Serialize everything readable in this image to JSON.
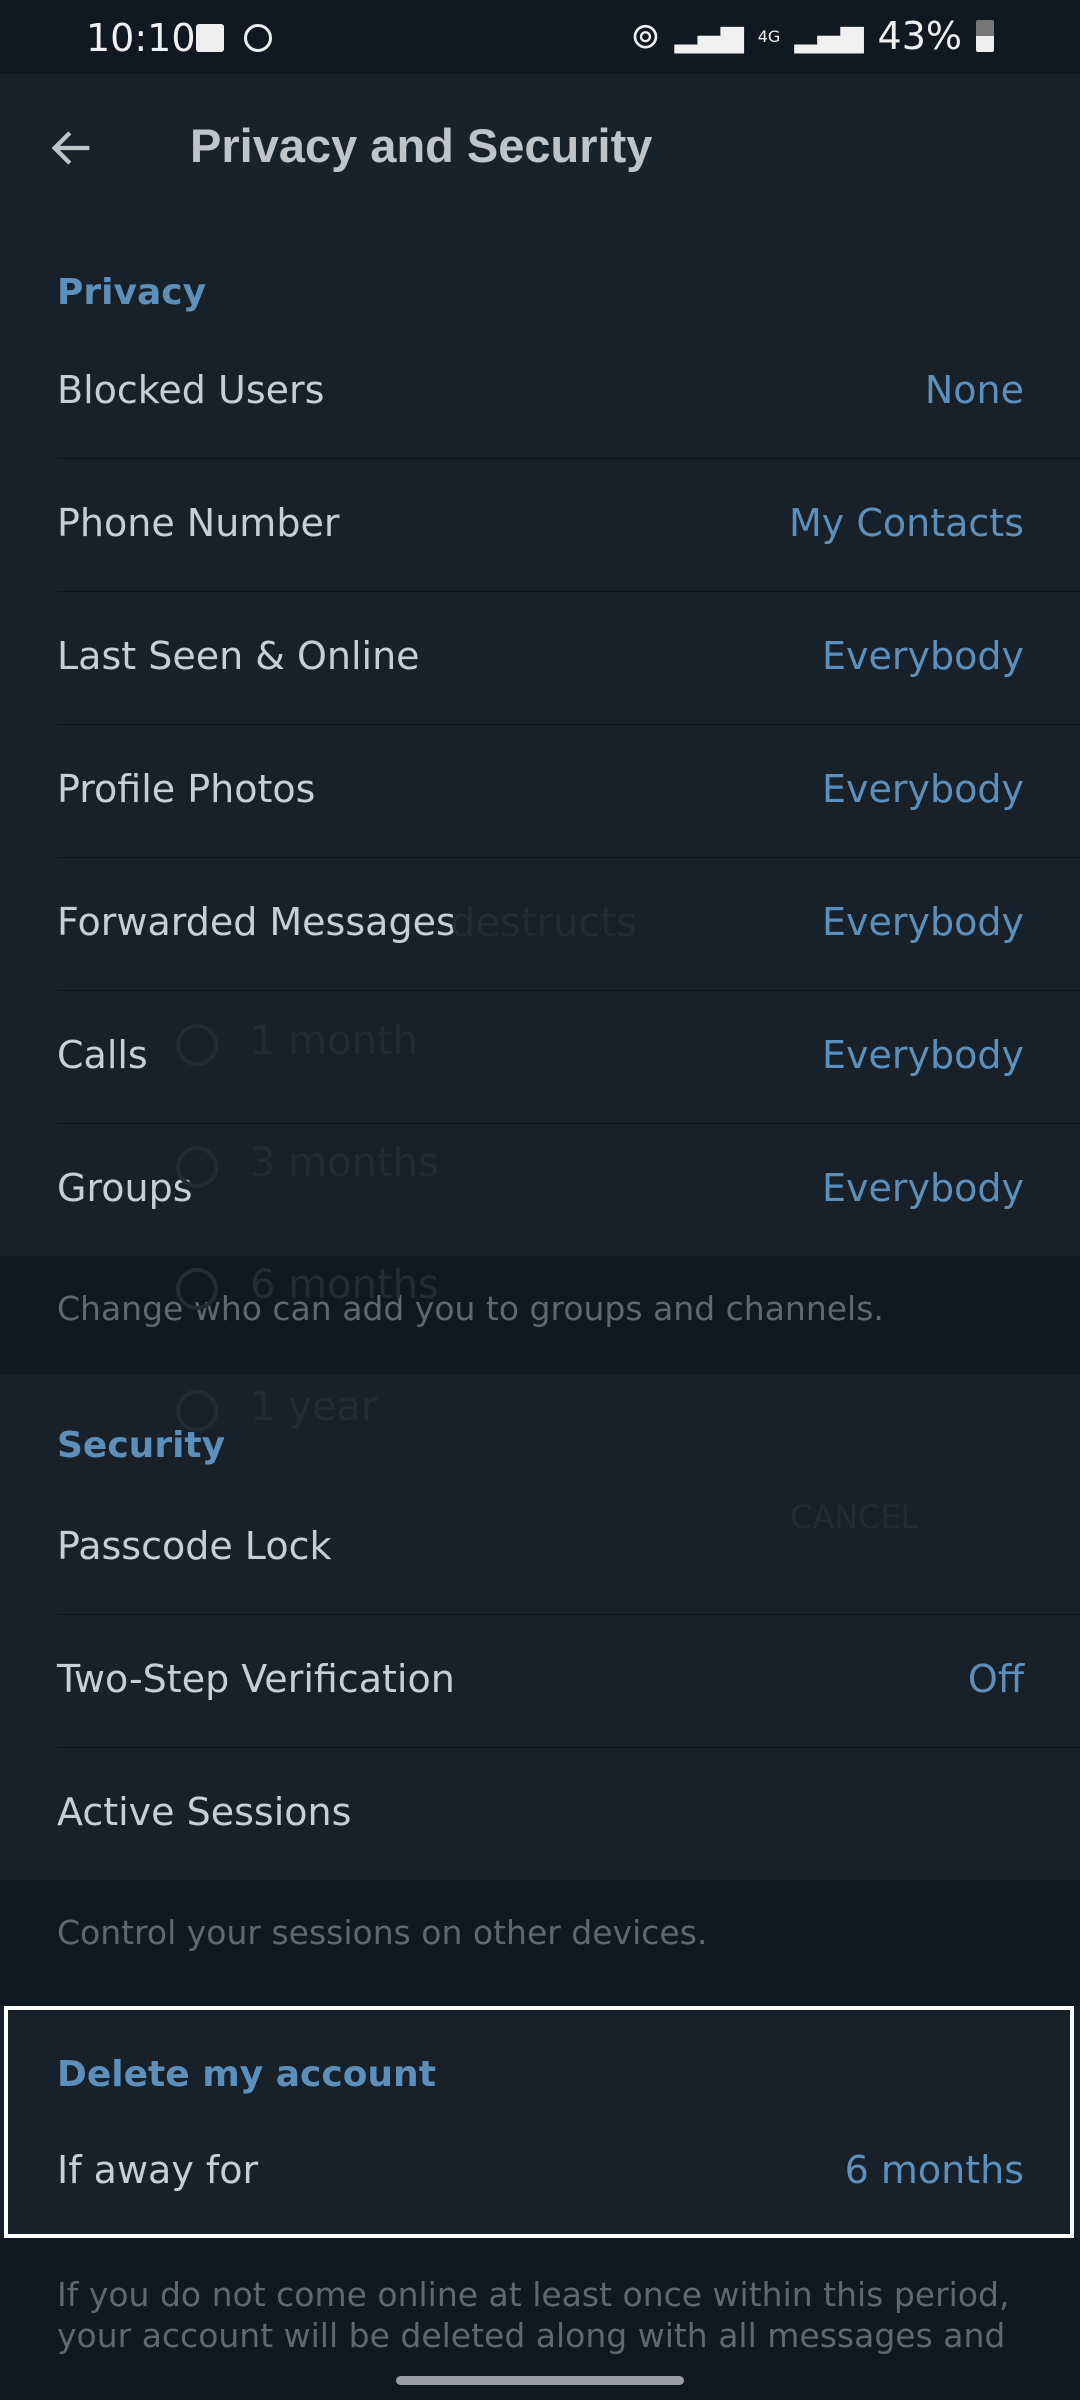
{
  "status_bar": {
    "time": "10:10",
    "battery": "43%",
    "network": "4G"
  },
  "header": {
    "title": "Privacy and Security",
    "back_icon": "arrow-left-icon"
  },
  "privacy": {
    "title": "Privacy",
    "items": [
      {
        "label": "Blocked Users",
        "value": "None"
      },
      {
        "label": "Phone Number",
        "value": "My Contacts"
      },
      {
        "label": "Last Seen & Online",
        "value": "Everybody"
      },
      {
        "label": "Profile Photos",
        "value": "Everybody"
      },
      {
        "label": "Forwarded Messages",
        "value": "Everybody"
      },
      {
        "label": "Calls",
        "value": "Everybody"
      },
      {
        "label": "Groups",
        "value": "Everybody"
      }
    ],
    "info": "Change who can add you to groups and channels."
  },
  "security": {
    "title": "Security",
    "items": [
      {
        "label": "Passcode Lock",
        "value": ""
      },
      {
        "label": "Two-Step Verification",
        "value": "Off"
      },
      {
        "label": "Active Sessions",
        "value": ""
      }
    ],
    "info": "Control your sessions on other devices."
  },
  "delete": {
    "title": "Delete my account",
    "label": "If away for",
    "value": "6 months",
    "info1": "If you do not come online at least once within this period,",
    "info2": "your account will be deleted along with all messages and"
  },
  "fading_dialog": {
    "title": "destructs",
    "options": [
      "1 month",
      "3 months",
      "6 months",
      "1 year"
    ],
    "cancel": "CANCEL"
  },
  "colors": {
    "accent": "#5d8fbb",
    "background": "#18202a",
    "highlight_border": "#ffffff"
  }
}
